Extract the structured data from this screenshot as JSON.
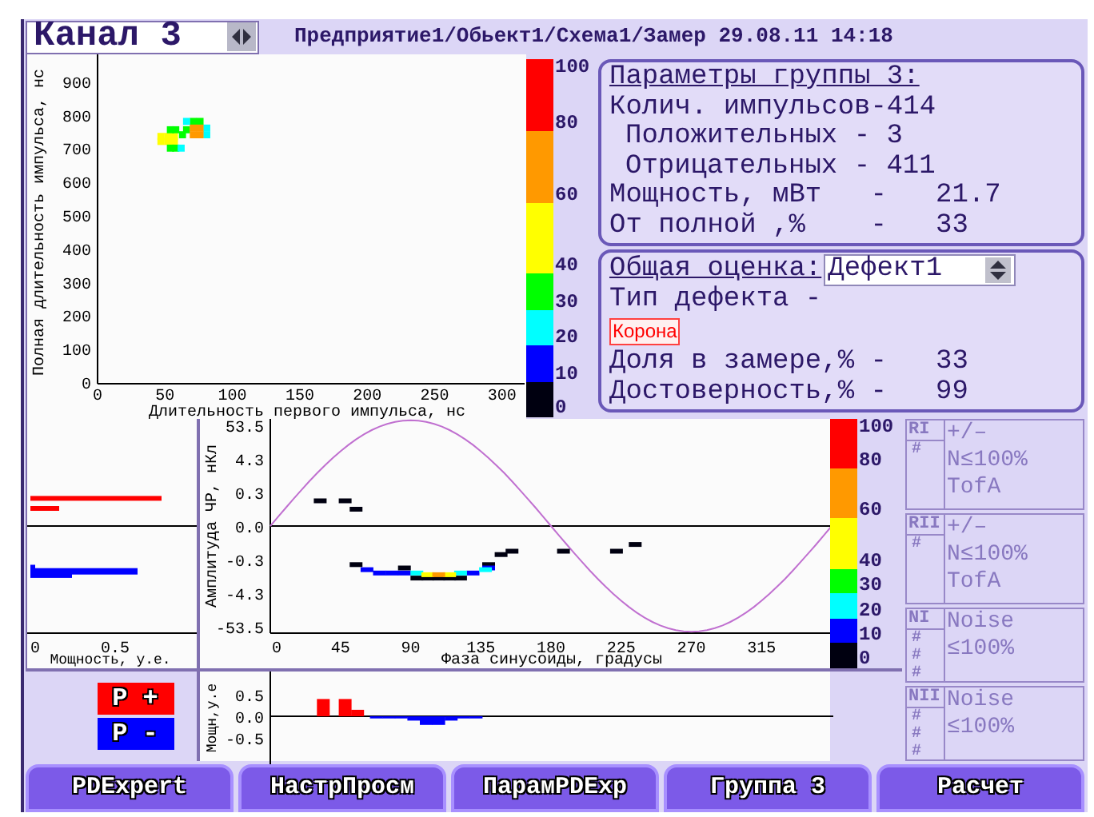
{
  "channel": {
    "label": "Канал 3"
  },
  "path": "Предприятие1/Обьект1/Схема1/Замер 29.08.11 14:18",
  "scatter": {
    "xlabel": "Длительность первого импульса, нс",
    "ylabel": "Полная длительность импульса, нс",
    "xticks": [
      "0",
      "50",
      "100",
      "150",
      "200",
      "250",
      "300"
    ],
    "yticks": [
      "900",
      "800",
      "700",
      "600",
      "500",
      "400",
      "300",
      "200",
      "100",
      "0"
    ]
  },
  "scatter_scale": {
    "labels": [
      "100",
      "80",
      "60",
      "40",
      "30",
      "20",
      "10",
      "0"
    ],
    "segments": [
      {
        "color": "#ff0000"
      },
      {
        "color": "#ff9900"
      },
      {
        "color": "#ffff00"
      },
      {
        "color": "#00ff00"
      },
      {
        "color": "#00ffff"
      },
      {
        "color": "#0000ff"
      },
      {
        "color": "#000010"
      }
    ]
  },
  "group_params": {
    "title": "Параметры группы 3:",
    "lines": [
      {
        "text": "Колич. импульсов-414",
        "children": [
          {
            "text": "Положительных - 3"
          },
          {
            "text": "Отрицательных - 411"
          }
        ]
      },
      {
        "text": "Мощность, мВт   -   21.7"
      },
      {
        "text": "От полной ,%    -   33"
      }
    ]
  },
  "assessment": {
    "label": "Общая оценка:",
    "select": {
      "value": "Дефект1"
    },
    "defect_type_label": "Тип дефекта -",
    "defect_tag": "Корона",
    "lines": [
      "Доля в замере,% -   33",
      "Достоверность,% -   99"
    ]
  },
  "power_histogram": {
    "xlabel": "Мощность, у.е.",
    "xticks": [
      "0",
      "0.5"
    ]
  },
  "phase_chart": {
    "xlabel": "Фаза синусоиды, градусы",
    "ylabel": "Амплитуда ЧР, нКл",
    "xticks": [
      "0",
      "45",
      "90",
      "135",
      "180",
      "225",
      "270",
      "315"
    ],
    "yticks": [
      "53.5",
      "4.3",
      "0.3",
      "0.0",
      "-0.3",
      "-4.3",
      "-53.5"
    ]
  },
  "phase_scale": {
    "labels": [
      "100",
      "80",
      "60",
      "40",
      "30",
      "20",
      "10",
      "0"
    ],
    "segments": [
      {
        "color": "#ff0000"
      },
      {
        "color": "#ff9900"
      },
      {
        "color": "#ffff00"
      },
      {
        "color": "#00ff00"
      },
      {
        "color": "#00ffff"
      },
      {
        "color": "#0000ff"
      },
      {
        "color": "#000010"
      }
    ]
  },
  "filters": [
    {
      "tag": "RI",
      "marks": [
        "#"
      ],
      "lines": [
        "+/–",
        "N≤100%",
        "TofA"
      ]
    },
    {
      "tag": "RII",
      "marks": [
        "#"
      ],
      "lines": [
        "+/–",
        "N≤100%",
        "TofA"
      ]
    },
    {
      "tag": "NI",
      "marks": [
        "#",
        "#",
        "#"
      ],
      "lines": [
        "Noise",
        "≤100%"
      ]
    },
    {
      "tag": "NII",
      "marks": [
        "#",
        "#",
        "#"
      ],
      "lines": [
        "Noise",
        "≤100%"
      ]
    }
  ],
  "legend": [
    {
      "label": "P +",
      "color": "#ff0000"
    },
    {
      "label": "P -",
      "color": "#0000ff"
    }
  ],
  "power_chart": {
    "ylabel": "Мощн,у.е",
    "yticks": [
      "0.5",
      "0.0",
      "-0.5"
    ]
  },
  "buttons": [
    "PDExpert",
    "НастрПросм",
    "ПарамPDExp",
    "Группа 3",
    "Расчет"
  ]
}
